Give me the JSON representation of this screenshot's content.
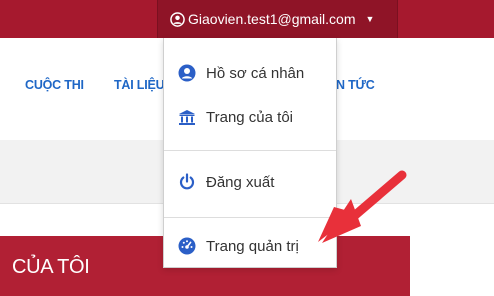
{
  "header": {
    "account_label": "Giaovien.test1@gmail.com",
    "caret": "▼"
  },
  "nav": {
    "items": [
      "CUỘC THI",
      "TÀI LIỆU",
      "N TỨC"
    ]
  },
  "dropdown": {
    "profile": "Hồ sơ cá nhân",
    "my_page": "Trang của tôi",
    "logout": "Đăng xuất",
    "admin": "Trang quản trị"
  },
  "page": {
    "section_title": "CỦA TÔI"
  },
  "colors": {
    "brand_red": "#a6192e",
    "nav_blue": "#1f67c6",
    "arrow_red": "#e8303a"
  }
}
